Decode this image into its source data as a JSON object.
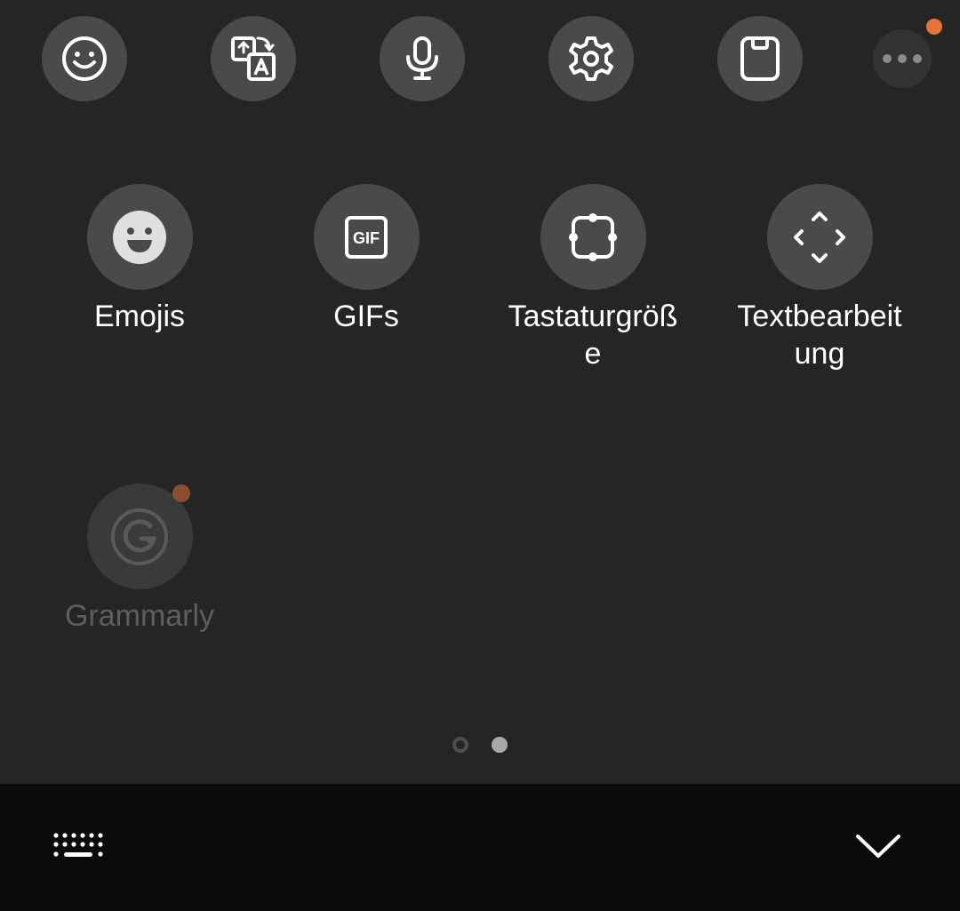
{
  "toolbar": {
    "icons": [
      "emoji-icon",
      "translate-icon",
      "microphone-icon",
      "gear-icon",
      "clipboard-icon",
      "more-icon"
    ],
    "notification_color": "#e5733a"
  },
  "panel": {
    "items": [
      {
        "label": "Emojis",
        "icon": "emoji-face-icon"
      },
      {
        "label": "GIFs",
        "icon": "gif-icon"
      },
      {
        "label": "Tastaturgröße",
        "icon": "keyboard-size-icon"
      },
      {
        "label": "Textbearbeitung",
        "icon": "text-editing-icon"
      },
      {
        "label": "Grammarly",
        "icon": "grammarly-icon"
      }
    ]
  },
  "pager": {
    "page_count": 2,
    "current_page": 2
  },
  "bottom_bar": {
    "icons": [
      "keyboard-icon",
      "chevron-down-icon"
    ]
  },
  "colors": {
    "background": "#252525",
    "button": "#4a4a4a",
    "accent": "#e5733a",
    "bottom_bar": "#0b0b0b"
  }
}
